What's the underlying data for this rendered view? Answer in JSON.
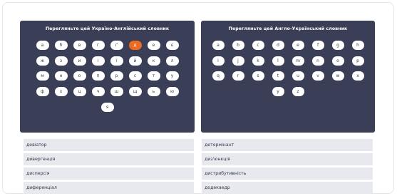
{
  "ua_en": {
    "title": "Перегляньте цей Україно-Англійський словник",
    "rows": [
      [
        "а",
        "б",
        "в",
        "г",
        "ґ",
        "д",
        "е",
        "є"
      ],
      [
        "ж",
        "з",
        "и",
        "і",
        "ї",
        "й",
        "к",
        "л"
      ],
      [
        "м",
        "н",
        "о",
        "п",
        "р",
        "с",
        "т",
        "у"
      ],
      [
        "ф",
        "х",
        "ц",
        "ч",
        "ш",
        "щ",
        "ь",
        "ю"
      ],
      [
        "я"
      ]
    ],
    "active_letter": "д"
  },
  "en_ua": {
    "title": "Перегляньте цей Англо-Український словник",
    "rows": [
      [
        "a",
        "b",
        "c",
        "d",
        "e",
        "f",
        "g",
        "h"
      ],
      [
        "i",
        "j",
        "k",
        "l",
        "m",
        "n",
        "o",
        "p"
      ],
      [
        "q",
        "r",
        "s",
        "t",
        "u",
        "v",
        "w",
        "x"
      ],
      [
        "y",
        "z"
      ]
    ]
  },
  "results_left": [
    "девіатор",
    "дивергенція",
    "дисперсія",
    "диференціал"
  ],
  "results_right": [
    "детермінант",
    "диз'юнкція",
    "дистрибутивність",
    "додекаедр"
  ],
  "colors": {
    "panel": "#3a3f57",
    "accent": "#ec6a21",
    "result_bg": "#e7e9ef"
  }
}
